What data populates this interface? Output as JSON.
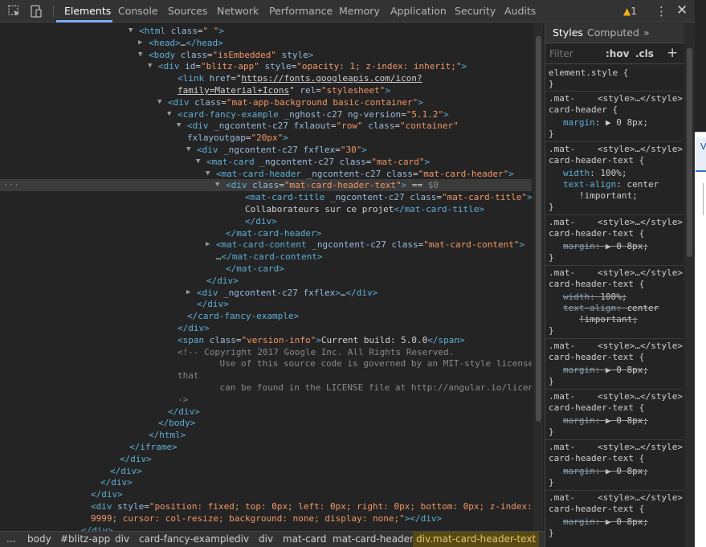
{
  "toolbar": {
    "tabs": [
      {
        "label": "Elements"
      },
      {
        "label": "Console"
      },
      {
        "label": "Sources"
      },
      {
        "label": "Network"
      },
      {
        "label": "Performance"
      },
      {
        "label": "Memory"
      },
      {
        "label": "Application"
      },
      {
        "label": "Security"
      },
      {
        "label": "Audits"
      }
    ],
    "warning_count": "1",
    "more_glyph": "⋮",
    "close_glyph": "✕"
  },
  "dom": {
    "lines": [
      {
        "parts": [
          [
            "tag",
            "<html"
          ],
          [
            "an",
            " class"
          ],
          [
            "txt",
            "="
          ],
          [
            "av",
            "\" \""
          ],
          [
            "tag",
            ">"
          ]
        ]
      },
      {
        "parts": [
          [
            "tag",
            "<head>"
          ],
          [
            "txt",
            "…"
          ],
          [
            "tag",
            "</head>"
          ]
        ]
      },
      {
        "parts": [
          [
            "tag",
            "<body"
          ],
          [
            "an",
            " class"
          ],
          [
            "txt",
            "="
          ],
          [
            "av",
            "\"isEmbedded\""
          ],
          [
            "an",
            " style"
          ],
          [
            "tag",
            ">"
          ]
        ]
      },
      {
        "parts": [
          [
            "tag",
            "<div"
          ],
          [
            "an",
            " id"
          ],
          [
            "txt",
            "="
          ],
          [
            "av",
            "\"blitz-app\""
          ],
          [
            "an",
            " style"
          ],
          [
            "txt",
            "="
          ],
          [
            "av",
            "\"opacity: 1; z-index: inherit;\""
          ],
          [
            "tag",
            ">"
          ]
        ]
      },
      {
        "parts": [
          [
            "tag",
            "<link"
          ],
          [
            "an",
            " href"
          ],
          [
            "txt",
            "=\""
          ],
          [
            "url",
            "https://fonts.googleapis.com/icon?"
          ]
        ]
      },
      {
        "parts": [
          [
            "url",
            "family=Material+Icons"
          ],
          [
            "txt",
            "\""
          ],
          [
            "an",
            " rel"
          ],
          [
            "txt",
            "="
          ],
          [
            "av",
            "\"stylesheet\""
          ],
          [
            "tag",
            ">"
          ]
        ]
      },
      {
        "parts": [
          [
            "tag",
            "<div"
          ],
          [
            "an",
            " class"
          ],
          [
            "txt",
            "="
          ],
          [
            "av",
            "\"mat-app-background basic-container\""
          ],
          [
            "tag",
            ">"
          ]
        ]
      },
      {
        "parts": [
          [
            "tag",
            "<card-fancy-example"
          ],
          [
            "an",
            " _nghost-c27 ng-version"
          ],
          [
            "txt",
            "="
          ],
          [
            "av",
            "\"5.1.2\""
          ],
          [
            "tag",
            ">"
          ]
        ]
      },
      {
        "parts": [
          [
            "tag",
            "<div"
          ],
          [
            "an",
            " _ngcontent-c27 fxlaout"
          ],
          [
            "txt",
            "="
          ],
          [
            "av",
            "\"row\""
          ],
          [
            "an",
            " class"
          ],
          [
            "txt",
            "="
          ],
          [
            "av",
            "\"container\""
          ]
        ]
      },
      {
        "parts": [
          [
            "an",
            "fxlayoutgap"
          ],
          [
            "txt",
            "="
          ],
          [
            "av",
            "\"20px\""
          ],
          [
            "tag",
            ">"
          ]
        ]
      },
      {
        "parts": [
          [
            "tag",
            "<div"
          ],
          [
            "an",
            " _ngcontent-c27 fxflex"
          ],
          [
            "txt",
            "="
          ],
          [
            "av",
            "\"30\""
          ],
          [
            "tag",
            ">"
          ]
        ]
      },
      {
        "parts": [
          [
            "tag",
            "<mat-card"
          ],
          [
            "an",
            " _ngcontent-c27 class"
          ],
          [
            "txt",
            "="
          ],
          [
            "av",
            "\"mat-card\""
          ],
          [
            "tag",
            ">"
          ]
        ]
      },
      {
        "parts": [
          [
            "tag",
            "<mat-card-header"
          ],
          [
            "an",
            " _ngcontent-c27 class"
          ],
          [
            "txt",
            "="
          ],
          [
            "av",
            "\"mat-card-header\""
          ],
          [
            "tag",
            ">"
          ]
        ]
      },
      {
        "parts": [
          [
            "tag",
            "<div"
          ],
          [
            "an",
            " class"
          ],
          [
            "txt",
            "="
          ],
          [
            "av",
            "\"mat-card-header-text\""
          ],
          [
            "tag",
            ">"
          ],
          [
            "txt",
            " == "
          ],
          [
            "cm",
            "$0"
          ]
        ]
      },
      {
        "parts": [
          [
            "tag",
            "<mat-card-title"
          ],
          [
            "an",
            " _ngcontent-c27 class"
          ],
          [
            "txt",
            "="
          ],
          [
            "av",
            "\"mat-card-title\""
          ],
          [
            "tag",
            ">"
          ]
        ]
      },
      {
        "parts": [
          [
            "txt",
            "Collaborateurs sur ce projet"
          ],
          [
            "tag",
            "</mat-card-title>"
          ]
        ]
      },
      {
        "parts": [
          [
            "tag",
            "</div>"
          ]
        ]
      },
      {
        "parts": [
          [
            "tag",
            "</mat-card-header>"
          ]
        ]
      },
      {
        "parts": [
          [
            "tag",
            "<mat-card-content"
          ],
          [
            "an",
            " _ngcontent-c27 class"
          ],
          [
            "txt",
            "="
          ],
          [
            "av",
            "\"mat-card-content\""
          ],
          [
            "tag",
            ">"
          ]
        ]
      },
      {
        "parts": [
          [
            "txt",
            "…"
          ],
          [
            "tag",
            "</mat-card-content>"
          ]
        ]
      },
      {
        "parts": [
          [
            "tag",
            "</mat-card>"
          ]
        ]
      },
      {
        "parts": [
          [
            "tag",
            "</div>"
          ]
        ]
      },
      {
        "parts": [
          [
            "tag",
            "<div"
          ],
          [
            "an",
            " _ngcontent-c27 fxflex"
          ],
          [
            "tag",
            ">"
          ],
          [
            "txt",
            "…"
          ],
          [
            "tag",
            "</div>"
          ]
        ]
      },
      {
        "parts": [
          [
            "tag",
            "</div>"
          ]
        ]
      },
      {
        "parts": [
          [
            "tag",
            "</card-fancy-example>"
          ]
        ]
      },
      {
        "parts": [
          [
            "tag",
            "</div>"
          ]
        ]
      },
      {
        "parts": [
          [
            "tag",
            "<span"
          ],
          [
            "an",
            " class"
          ],
          [
            "txt",
            "="
          ],
          [
            "av",
            "\"version-info\""
          ],
          [
            "tag",
            ">"
          ],
          [
            "txt",
            "Current build: 5.0.0"
          ],
          [
            "tag",
            "</span>"
          ]
        ]
      },
      {
        "parts": [
          [
            "cm",
            "<!-- Copyright 2017 Google Inc. All Rights Reserved."
          ]
        ]
      },
      {
        "parts": [
          [
            "cm",
            "    Use of this source code is governed by an MIT-style license"
          ]
        ]
      },
      {
        "parts": [
          [
            "cm",
            "that"
          ]
        ]
      },
      {
        "parts": [
          [
            "cm",
            "    can be found in the LICENSE file at http://angular.io/license -"
          ]
        ]
      },
      {
        "parts": [
          [
            "cm",
            "->"
          ]
        ]
      },
      {
        "parts": [
          [
            "tag",
            "</div>"
          ]
        ]
      },
      {
        "parts": [
          [
            "tag",
            "</body>"
          ]
        ]
      },
      {
        "parts": [
          [
            "tag",
            "</html>"
          ]
        ]
      },
      {
        "parts": [
          [
            "tag",
            "</iframe>"
          ]
        ]
      },
      {
        "parts": [
          [
            "tag",
            "</div>"
          ]
        ]
      },
      {
        "parts": [
          [
            "tag",
            "</div>"
          ]
        ]
      },
      {
        "parts": [
          [
            "tag",
            "</div>"
          ]
        ]
      },
      {
        "parts": [
          [
            "tag",
            "</div>"
          ]
        ]
      },
      {
        "parts": [
          [
            "tag",
            "<div"
          ],
          [
            "an",
            " style"
          ],
          [
            "txt",
            "="
          ],
          [
            "av",
            "\"position: fixed; top: 0px; left: 0px; right: 0px; bottom: 0px; z-index:"
          ]
        ]
      },
      {
        "parts": [
          [
            "av",
            "9999; cursor: col-resize; background: none; display: none;\""
          ],
          [
            "tag",
            ">"
          ],
          [
            "tag",
            "</div>"
          ]
        ]
      },
      {
        "parts": [
          [
            "tag",
            "</div>"
          ]
        ]
      }
    ]
  },
  "breadcrumb": {
    "items": [
      {
        "label": "..."
      },
      {
        "label": "body"
      },
      {
        "label": "#blitz-app"
      },
      {
        "label": "div"
      },
      {
        "label": "card-fancy-example"
      },
      {
        "label": "div"
      },
      {
        "label": "div"
      },
      {
        "label": "mat-card"
      },
      {
        "label": "mat-card-header"
      },
      {
        "label": "div.mat-card-header-text"
      }
    ]
  },
  "styles": {
    "tabs": [
      {
        "label": "Styles"
      },
      {
        "label": "Computed"
      },
      {
        "label": "»"
      }
    ],
    "filter_placeholder": "Filter",
    "hov": ":hov",
    "cls": ".cls",
    "add": "+",
    "element_style": "element.style {",
    "close_brace": "}",
    "rules": [
      {
        "sel1": ".mat-",
        "src": "<style>…</style>",
        "sel2": "card-header {",
        "decls": [
          {
            "prop": "margin",
            "val": "▶ 0 8px;",
            "struck": false
          }
        ]
      },
      {
        "sel1": ".mat-",
        "src": "<style>…</style>",
        "sel2": "card-header-text {",
        "decls": [
          {
            "prop": "width",
            "val": "100%;",
            "struck": false
          },
          {
            "prop": "text-align",
            "val": "center",
            "struck": false
          },
          {
            "prop": "",
            "val": "!important;",
            "struck": false
          }
        ]
      },
      {
        "sel1": ".mat-",
        "src": "<style>…</style>",
        "sel2": "card-header-text {",
        "decls": [
          {
            "prop": "margin",
            "val": "▶ 0 8px;",
            "struck": true
          }
        ]
      },
      {
        "sel1": ".mat-",
        "src": "<style>…</style>",
        "sel2": "card-header-text {",
        "decls": [
          {
            "prop": "width",
            "val": "100%;",
            "struck": true
          },
          {
            "prop": "text-align",
            "val": "center",
            "struck": true
          },
          {
            "prop": "",
            "val": "!important;",
            "struck": true
          }
        ]
      },
      {
        "sel1": ".mat-",
        "src": "<style>…</style>",
        "sel2": "card-header-text {",
        "decls": [
          {
            "prop": "margin",
            "val": "▶ 0 8px;",
            "struck": true
          }
        ]
      },
      {
        "sel1": ".mat-",
        "src": "<style>…</style>",
        "sel2": "card-header-text {",
        "decls": [
          {
            "prop": "margin",
            "val": "▶ 0 8px;",
            "struck": true
          }
        ]
      },
      {
        "sel1": ".mat-",
        "src": "<style>…</style>",
        "sel2": "card-header-text {",
        "decls": [
          {
            "prop": "margin",
            "val": "▶ 0 8px;",
            "struck": true
          }
        ]
      },
      {
        "sel1": ".mat-",
        "src": "<style>…</style>",
        "sel2": "card-header-text {",
        "decls": [
          {
            "prop": "margin",
            "val": "▶ 0 8px;",
            "struck": true
          }
        ]
      }
    ]
  },
  "colors": {
    "tag": "#5db0d7",
    "attr_name": "#9bbbdc",
    "attr_value": "#f29766",
    "comment": "#898989",
    "accent": "#7cacf8",
    "warning": "#f3ae1a"
  }
}
